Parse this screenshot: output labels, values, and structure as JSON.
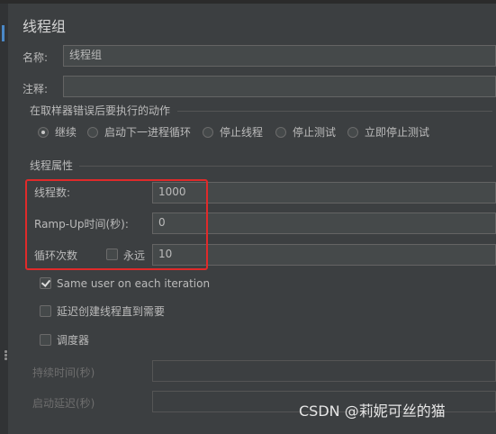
{
  "panel": {
    "title": "线程组",
    "name_label": "名称:",
    "name_value": "线程组",
    "comment_label": "注释:",
    "comment_value": ""
  },
  "sampler_error": {
    "label": "在取样器错误后要执行的动作",
    "options": [
      "继续",
      "启动下一进程循环",
      "停止线程",
      "停止测试",
      "立即停止测试"
    ],
    "selected": "继续"
  },
  "thread_props": {
    "label": "线程属性",
    "threads_label": "线程数:",
    "threads_value": "1000",
    "rampup_label": "Ramp-Up时间(秒):",
    "rampup_value": "0",
    "loop_label": "循环次数",
    "forever_label": "永远",
    "forever_checked": false,
    "loop_value": "10",
    "same_user_label": "Same user on each iteration",
    "same_user_checked": true,
    "delay_label": "延迟创建线程直到需要",
    "delay_checked": false,
    "scheduler_label": "调度器",
    "scheduler_checked": false,
    "duration_label": "持续时间(秒)",
    "duration_value": "",
    "startup_delay_label": "启动延迟(秒)",
    "startup_delay_value": ""
  },
  "watermark": "CSDN @莉妮可丝的猫",
  "colors": {
    "background": "#3c3f41",
    "field": "#45494a",
    "text": "#bbbbbb",
    "highlight_box": "#e02a2a"
  }
}
